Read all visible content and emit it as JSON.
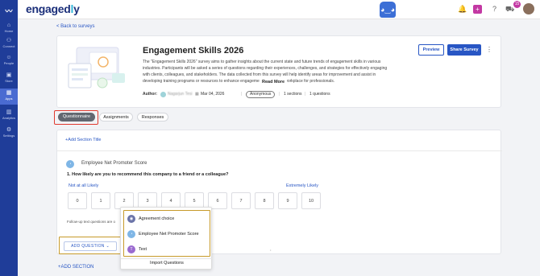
{
  "sidebar": {
    "items": [
      {
        "label": "Home",
        "icon": "⌂"
      },
      {
        "label": "Connect",
        "icon": "⚇"
      },
      {
        "label": "People",
        "icon": "☺"
      },
      {
        "label": "Store",
        "icon": "▣"
      },
      {
        "label": "Apps",
        "icon": "▦"
      },
      {
        "label": "Analytics",
        "icon": "▥"
      },
      {
        "label": "Settings",
        "icon": "⚙"
      }
    ],
    "active": "Apps"
  },
  "topbar": {
    "brand_left": "engaged",
    "brand_dot": "l",
    "brand_right": "y",
    "notifications_count": "15"
  },
  "back_link": "< Back to surveys",
  "survey": {
    "title": "Engagement Skills 2026",
    "description": "The \"Engagement Skills 2026\" survey aims to gather insights about the current state and future trends of engagement skills in various industries. Participants will be asked a series of questions regarding their experiences, challenges, and strategies for effectively engaging with clients, colleagues, and stakeholders. The data collected from this survey will help identify areas for improvement and assist in developing training programs or resources to enhance engagement skills in the workplace for professionals.",
    "read_more": "Read More",
    "author_label": "Author:",
    "author_name": "Nagarjun Tesi",
    "date": "Mar 04, 2026",
    "visibility": "Anonymous",
    "sections": "1 sections",
    "questions": "1 questions",
    "preview": "Preview",
    "share": "Share Survey"
  },
  "tabs": [
    {
      "label": "Questionnaire",
      "active": true
    },
    {
      "label": "Assignments",
      "active": false
    },
    {
      "label": "Responses",
      "active": false
    }
  ],
  "questionnaire": {
    "add_section_title": "+Add Section Title",
    "section_name": "Employee Net Promoter Score",
    "question": "1. How likely are you to recommend this company to a friend or a colleague?",
    "low_label": "Not at all Likely",
    "high_label": "Extremely Likely",
    "scale": [
      "0",
      "1",
      "2",
      "3",
      "4",
      "5",
      "6",
      "7",
      "8",
      "9",
      "10"
    ],
    "followup_note": "Follow-up text questions are o",
    "add_question": "ADD QUESTION",
    "add_section": "+ADD SECTION"
  },
  "dropdown": {
    "items": [
      {
        "label": "Agreement choice",
        "icon": "◉",
        "color": "#6b74a8"
      },
      {
        "label": "Employee Net Promoter Score",
        "icon": "◔",
        "color": "#7fb6e6"
      },
      {
        "label": "Text",
        "icon": "T",
        "color": "#9a6ad0"
      }
    ],
    "import": "Import Questions"
  },
  "colors": {
    "accent": "#2856c4",
    "sidebar": "#1f3d99",
    "highlight_red": "#e03a2f",
    "highlight_gold": "#c79a2a"
  }
}
